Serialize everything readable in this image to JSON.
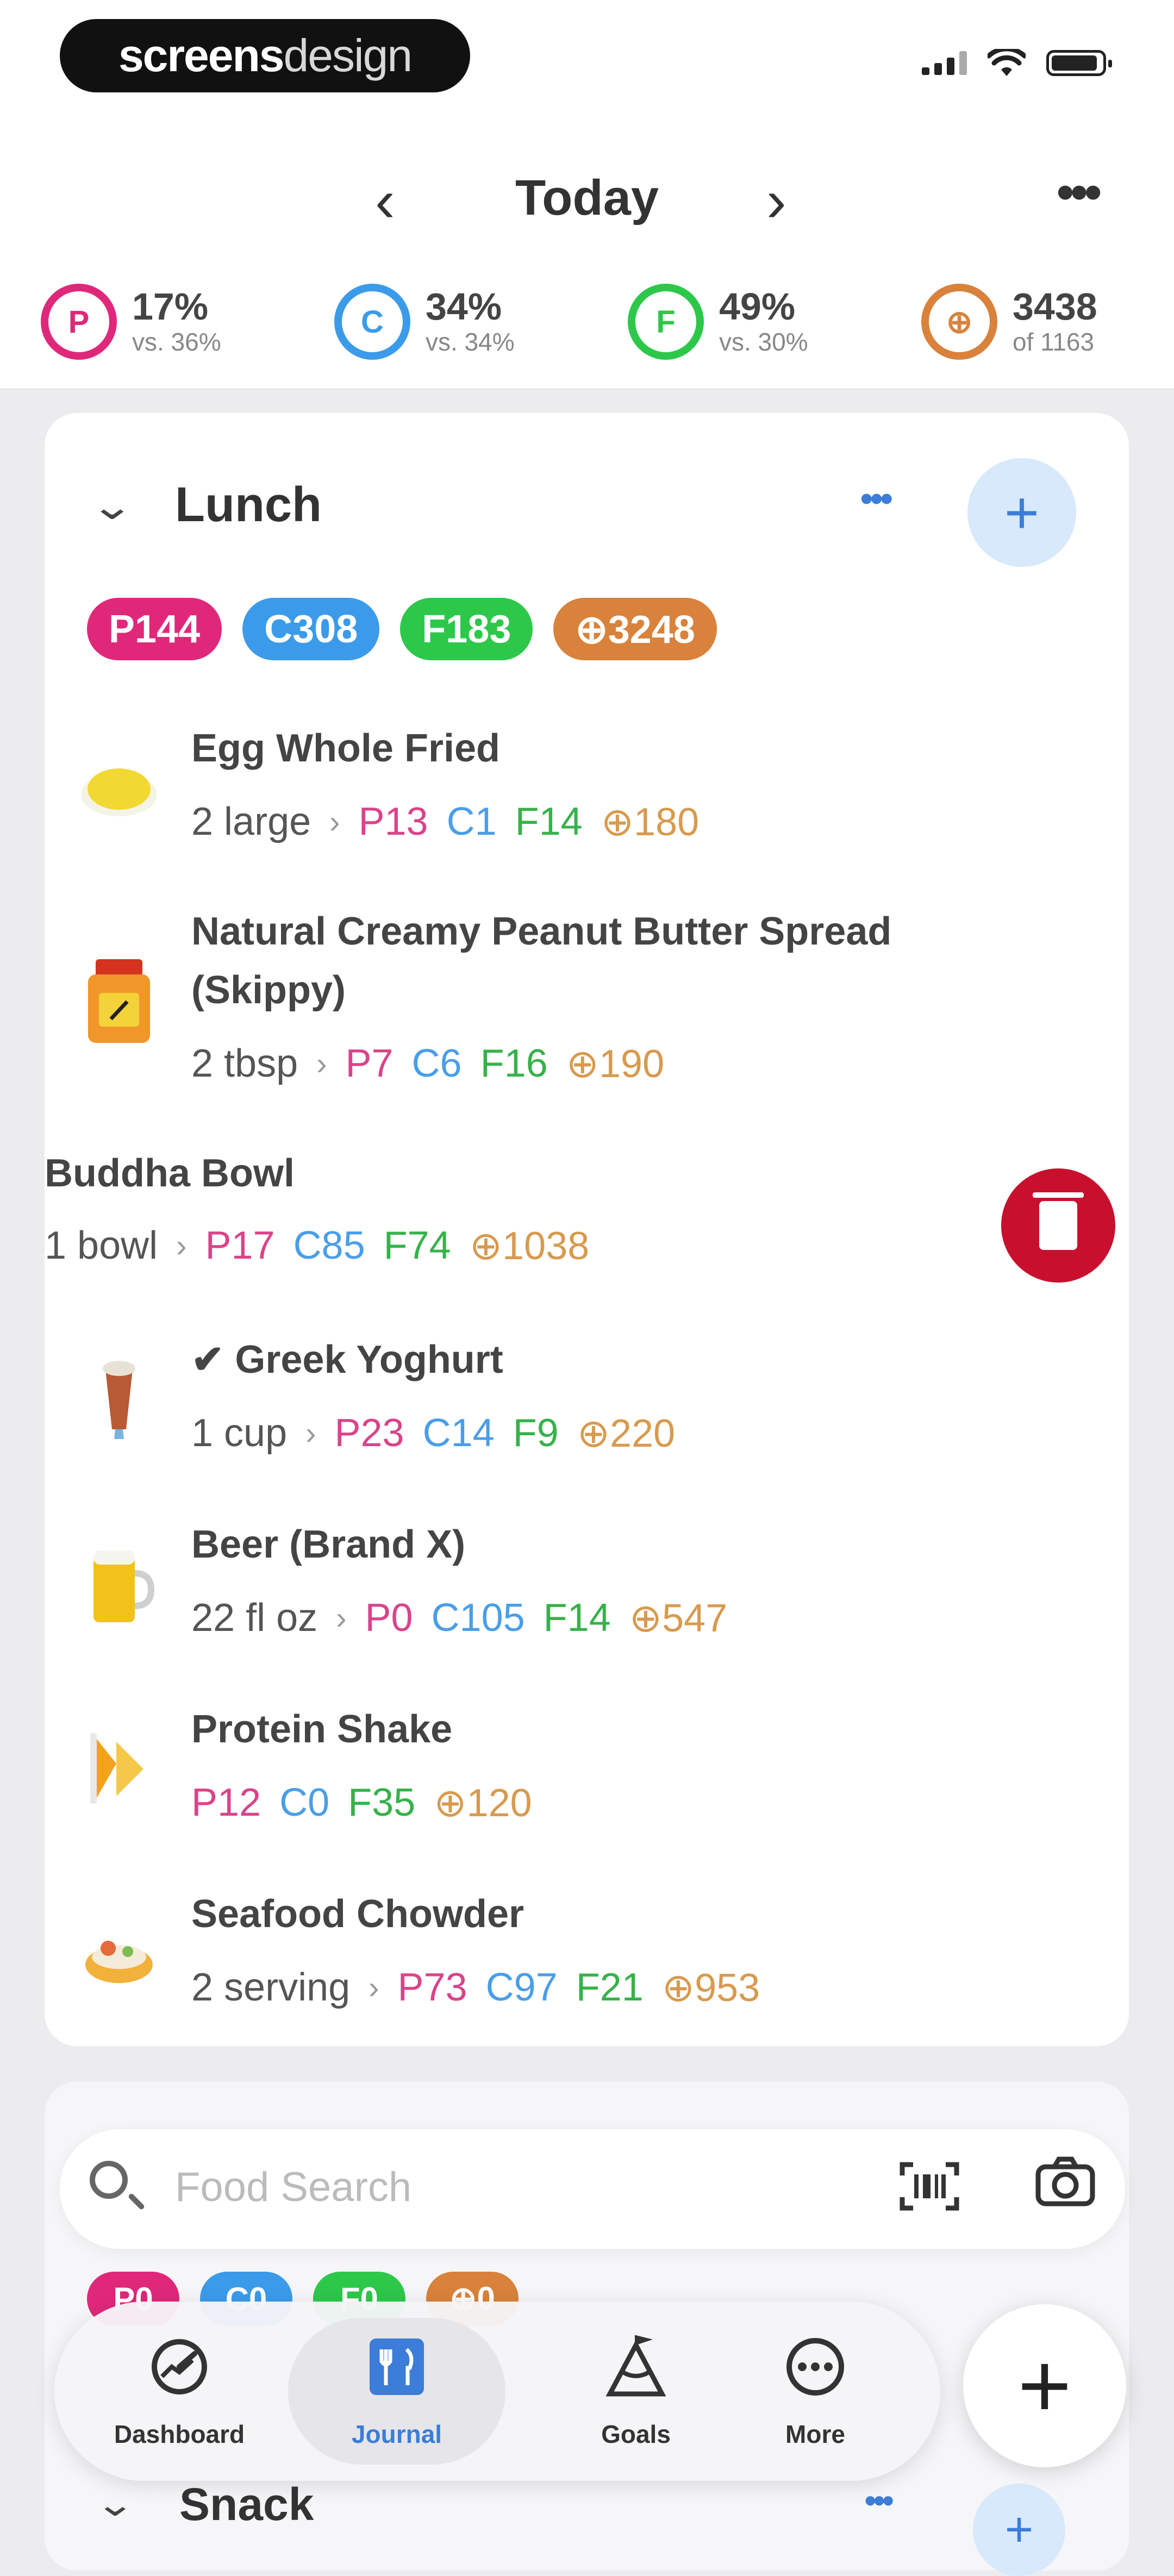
{
  "brand": {
    "bold": "screens",
    "light": "design"
  },
  "date_nav": {
    "title": "Today",
    "prev": "‹",
    "next": "›",
    "more": "•••"
  },
  "macros": [
    {
      "letter": "P",
      "pct": "17%",
      "vs": "vs. 36%",
      "color": "#e0287a"
    },
    {
      "letter": "C",
      "pct": "34%",
      "vs": "vs. 34%",
      "color": "#3b9bea"
    },
    {
      "letter": "F",
      "pct": "49%",
      "vs": "vs. 30%",
      "color": "#2dc84a"
    },
    {
      "letter": "⊕",
      "pct": "3438",
      "vs": "of 1163",
      "color": "#d9823b"
    }
  ],
  "meal": {
    "title": "Lunch",
    "chevron": "⌄",
    "dots": "•••",
    "add": "+",
    "pills": [
      {
        "label": "P144",
        "color": "#e0287a"
      },
      {
        "label": "C308",
        "color": "#3b9bea"
      },
      {
        "label": "F183",
        "color": "#2dc84a"
      },
      {
        "label": "⊕3248",
        "color": "#d9823b"
      }
    ],
    "items": [
      {
        "name": "Egg Whole Fried",
        "qty": "2 large",
        "p": "P13",
        "c": "C1",
        "f": "F14",
        "k": "⊕180",
        "icon": "egg-icon"
      },
      {
        "name": "Natural Creamy Peanut Butter Spread (Skippy)",
        "qty": "2 tbsp",
        "p": "P7",
        "c": "C6",
        "f": "F16",
        "k": "⊕190",
        "icon": "jar-icon"
      },
      {
        "name": "Buddha Bowl",
        "qty": "1 bowl",
        "p": "P17",
        "c": "C85",
        "f": "F74",
        "k": "⊕1038",
        "icon": ""
      },
      {
        "name": "✔ Greek Yoghurt",
        "qty": "1 cup",
        "p": "P23",
        "c": "C14",
        "f": "F9",
        "k": "⊕220",
        "icon": "yoghurt-icon"
      },
      {
        "name": "Beer (Brand X)",
        "qty": "22 fl oz",
        "p": "P0",
        "c": "C105",
        "f": "F14",
        "k": "⊕547",
        "icon": "beer-icon"
      },
      {
        "name": "Protein Shake",
        "qty": "",
        "p": "P12",
        "c": "C0",
        "f": "F35",
        "k": "⊕120",
        "icon": "shake-icon"
      },
      {
        "name": "Seafood Chowder",
        "qty": "2 serving",
        "p": "P73",
        "c": "C97",
        "f": "F21",
        "k": "⊕953",
        "icon": "chowder-icon"
      }
    ]
  },
  "search": {
    "placeholder": "Food Search"
  },
  "snack": {
    "title": "Snack",
    "pills": [
      {
        "label": "P0",
        "color": "#e0287a"
      },
      {
        "label": "C0",
        "color": "#3b9bea"
      },
      {
        "label": "F0",
        "color": "#2dc84a"
      },
      {
        "label": "⊕0",
        "color": "#d9823b"
      }
    ]
  },
  "tabs": [
    {
      "label": "Dashboard",
      "icon": "dashboard-icon"
    },
    {
      "label": "Journal",
      "icon": "journal-icon"
    },
    {
      "label": "Goals",
      "icon": "goals-icon"
    },
    {
      "label": "More",
      "icon": "more-icon"
    }
  ],
  "fab": "+",
  "separator": "›"
}
